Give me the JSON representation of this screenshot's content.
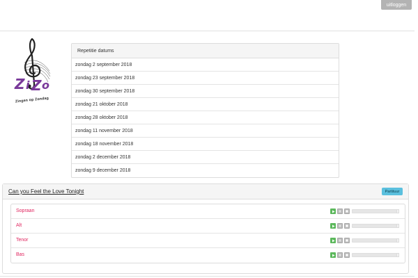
{
  "header": {
    "logout_label": "uitloggen"
  },
  "logo": {
    "caption": "Zingen op Zondag",
    "icon": "treble-clef-logo"
  },
  "rehearsals": {
    "title": "Repetitie datums",
    "dates": [
      "zondag 2 september 2018",
      "zondag 23 september 2018",
      "zondag 30 september 2018",
      "zondag 21 oktober 2018",
      "zondag 28 oktober 2018",
      "zondag 11 november 2018",
      "zondag 18 november 2018",
      "zondag 2 december 2018",
      "zondag 9 december 2018"
    ]
  },
  "song": {
    "title": "Can you Feel the Love Tonight",
    "score_label": "Partituur",
    "voices": [
      {
        "name": "Sopraan",
        "progress": 0
      },
      {
        "name": "Alt",
        "progress": 0
      },
      {
        "name": "Tenor",
        "progress": 0
      },
      {
        "name": "Bas",
        "progress": 0
      }
    ]
  },
  "colors": {
    "accent_link": "#e0245e",
    "play_button": "#5cb85c",
    "score_button": "#5bc0de"
  }
}
